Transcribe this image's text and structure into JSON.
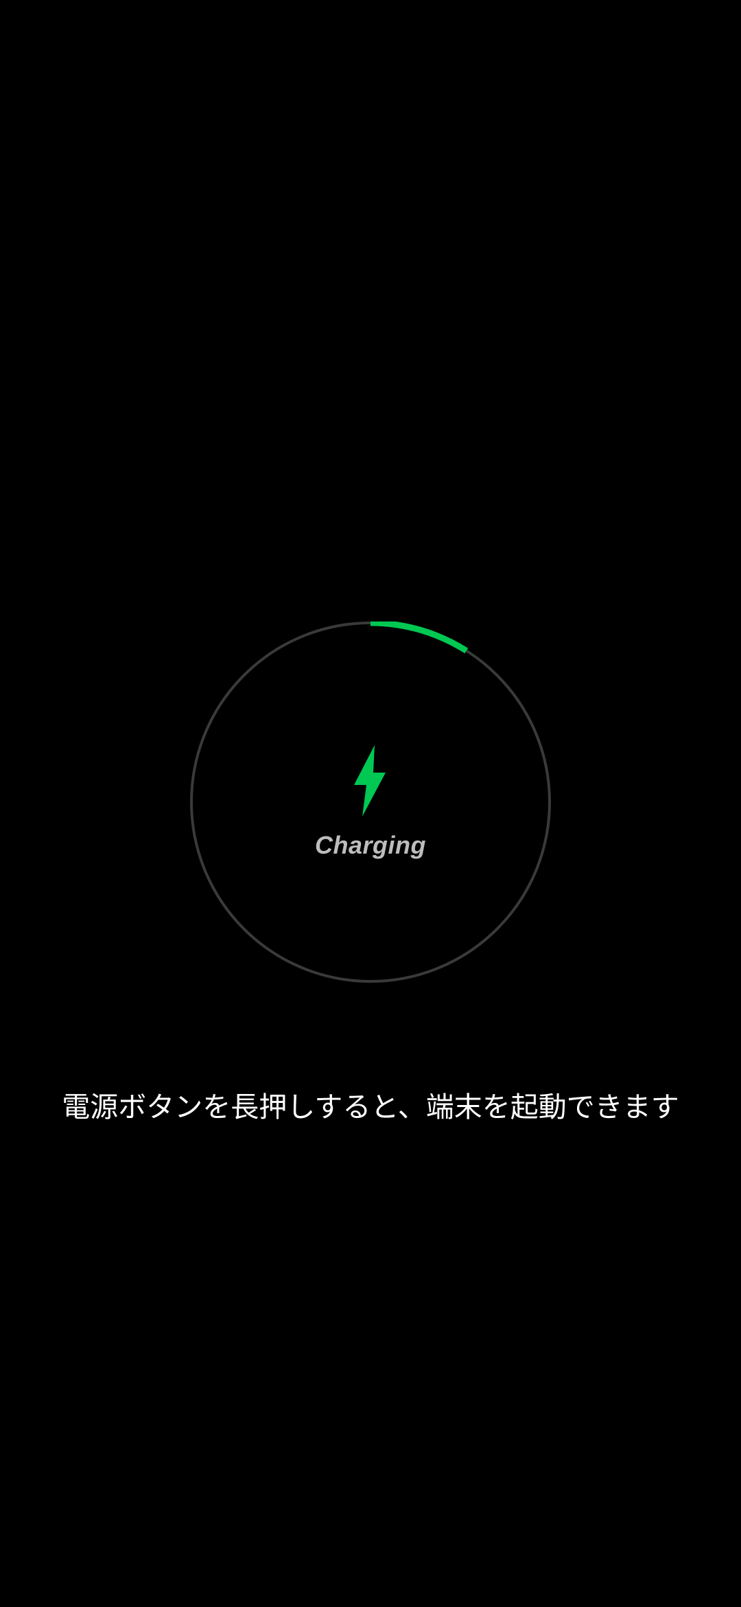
{
  "charging": {
    "status_label": "Charging",
    "progress_fraction": 0.09,
    "icon": "lightning-bolt-icon",
    "colors": {
      "accent": "#00c853",
      "track": "#3a3a3a",
      "label": "#bdbdbd",
      "background": "#000000"
    }
  },
  "hint": {
    "text": "電源ボタンを長押しすると、端末を起動できます"
  }
}
